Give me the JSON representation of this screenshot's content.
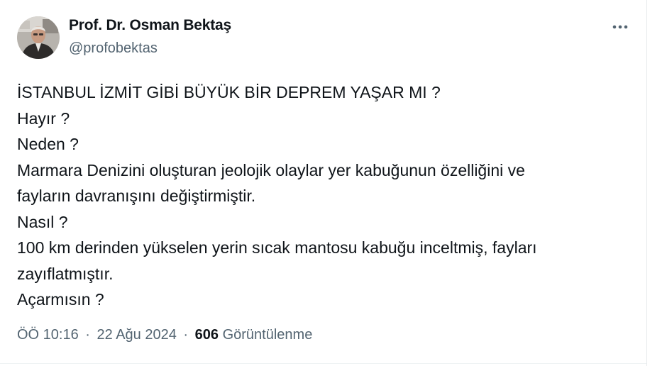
{
  "author": {
    "display_name": "Prof. Dr. Osman Bektaş",
    "handle": "@profobektas"
  },
  "tweet": {
    "lines": [
      "İSTANBUL İZMİT GİBİ BÜYÜK BİR DEPREM YAŞAR MI ?",
      "Hayır ?",
      "Neden ?",
      "Marmara Denizini oluşturan jeolojik olaylar yer kabuğunun özelliğini ve",
      "fayların davranışını değiştirmiştir.",
      "Nasıl ?",
      "100 km derinden yükselen yerin sıcak mantosu kabuğu inceltmiş, fayları",
      "zayıflatmıştır.",
      "Açarmısın ?"
    ]
  },
  "meta": {
    "time": "ÖÖ 10:16",
    "separator_1": "·",
    "date": "22 Ağu 2024",
    "separator_2": "·",
    "views_count": "606",
    "views_label": "Görüntülenme"
  },
  "icons": {
    "more": "more-dots-icon",
    "avatar": "profile-photo"
  },
  "colors": {
    "text_primary": "#0f1419",
    "text_secondary": "#536471",
    "border": "#eff3f4"
  }
}
